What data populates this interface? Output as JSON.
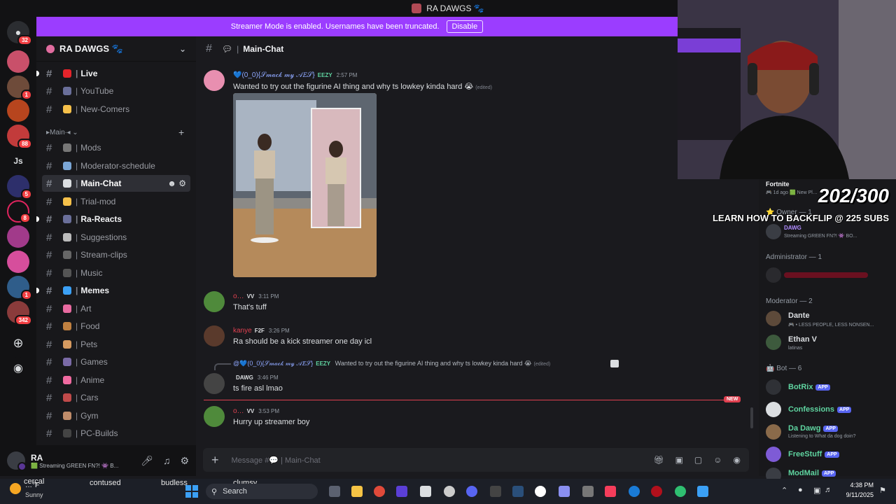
{
  "titlebar": {
    "server_name": "RA DAWGS 🐾"
  },
  "banner": {
    "text": "Streamer Mode is enabled. Usernames have been truncated.",
    "disable_label": "Disable"
  },
  "rail": {
    "badges": [
      "32",
      "1",
      "88",
      "Js",
      "5",
      "8",
      "1",
      "342"
    ],
    "colors": {
      "rail_bg": "#121214",
      "badge": "#f23f43"
    }
  },
  "sidebar": {
    "server_title": "RA DAWGS 🐾",
    "category_main": "▸Main∙◂ ⌄",
    "channels": [
      {
        "name": "Live",
        "icon": "red-dot-icon",
        "unread": true
      },
      {
        "name": "YouTube",
        "icon": "paw-icon",
        "unread": false
      },
      {
        "name": "New-Comers",
        "icon": "wave-icon",
        "unread": false
      },
      {
        "name": "Mods",
        "icon": "swords-icon",
        "unread": false
      },
      {
        "name": "Moderator-schedule",
        "icon": "calendar-icon",
        "unread": false
      },
      {
        "name": "Main-Chat",
        "icon": "speech-bubble-icon",
        "unread": false,
        "active": true
      },
      {
        "name": "Trial-mod",
        "icon": "emoji-icon",
        "unread": false
      },
      {
        "name": "Ra-Reacts",
        "icon": "paw-icon",
        "unread": true
      },
      {
        "name": "Suggestions",
        "icon": "thought-bubble-icon",
        "unread": false
      },
      {
        "name": "Stream-clips",
        "icon": "camera-icon",
        "unread": false
      },
      {
        "name": "Music",
        "icon": "music-icon",
        "unread": false
      },
      {
        "name": "Memes",
        "icon": "feather-icon",
        "unread": true
      },
      {
        "name": "Art",
        "icon": "palette-icon",
        "unread": false
      },
      {
        "name": "Food",
        "icon": "burger-icon",
        "unread": false
      },
      {
        "name": "Pets",
        "icon": "pet-icon",
        "unread": false
      },
      {
        "name": "Games",
        "icon": "controller-icon",
        "unread": false
      },
      {
        "name": "Anime",
        "icon": "flower-icon",
        "unread": false
      },
      {
        "name": "Cars",
        "icon": "car-icon",
        "unread": false
      },
      {
        "name": "Gym",
        "icon": "muscle-icon",
        "unread": false
      },
      {
        "name": "PC-Builds",
        "icon": "computer-icon",
        "unread": false
      }
    ],
    "separator": "|",
    "hash": "#"
  },
  "user_panel": {
    "name": "RA",
    "status": "🟩 Streaming GREEN FN?! 👾 B..."
  },
  "chat": {
    "header_channel": "Main-Chat",
    "header_prefix": "#",
    "messages": [
      {
        "author": "💙(0_0){𝒮𝓂𝒶𝒸𝓀 𝓂𝓎 𝒜𝐸𝒮}",
        "tag": "EEZY",
        "time": "2:57 PM",
        "text": "Wanted to try out the figurine AI thing and why ts lowkey kinda hard 😭",
        "edited": "(edited)"
      },
      {
        "author": "o…",
        "tag": "VV",
        "time": "3:11 PM",
        "text": "That's tuff"
      },
      {
        "author": "kanye",
        "tag": "F2F",
        "time": "3:26 PM",
        "text": "Ra should be a kick streamer one day icl"
      },
      {
        "reply_author": "@💙(0_0){𝒮𝓂𝒶𝒸𝓀 𝓂𝓎 𝒜𝐸𝒮}",
        "reply_tag": "EEZY",
        "reply_text": "Wanted to try out the figurine AI thing and why ts lowkey kinda hard 😭",
        "reply_edited": "(edited)",
        "author": "",
        "tag": "DAWG",
        "time": "3:46 PM",
        "text": "ts fire asl lmao"
      },
      {
        "author": "o…",
        "tag": "VV",
        "time": "3:53 PM",
        "text": "Hurry up streamer boy"
      }
    ],
    "new_label": "NEW",
    "input_placeholder": "Message #💬 | Main-Chat",
    "accent_colors": {
      "eezy": "#6f9dff",
      "vv": "#e04050",
      "kanye": "#e04050",
      "dawg": "#b08cff"
    }
  },
  "members": {
    "top_game": {
      "title": "Fortnite",
      "sub": "🎮 1d ago  🟩 New Pl…"
    },
    "owner_group": "⭐ Owner — 1",
    "owner": {
      "tag": "DAWG",
      "sub": "Streaming GREEN FN?! 👾 BO..."
    },
    "admin_group": "Administrator — 1",
    "mod_group": "Moderator — 2",
    "mods": [
      {
        "name": "Dante",
        "sub": "🎮 • LESS PEOPLE, LESS NONSEN..."
      },
      {
        "name": "Ethan V",
        "sub": "latinas"
      }
    ],
    "bot_group": "🤖 Bot — 6",
    "bots": [
      {
        "name": "BotRix",
        "badge": "APP",
        "sub": ""
      },
      {
        "name": "Confessions",
        "badge": "APP",
        "sub": ""
      },
      {
        "name": "Da Dawg",
        "badge": "APP",
        "sub": "Listening to What da dog doin?"
      },
      {
        "name": "FreeStuff",
        "badge": "APP",
        "sub": ""
      },
      {
        "name": "ModMail",
        "badge": "APP",
        "sub": ""
      }
    ]
  },
  "stream_overlay": {
    "count": "202/300",
    "goal": "LEARN HOW TO BACKFLIP @ 225 SUBS"
  },
  "taskbar": {
    "weather": {
      "temp": "…°F",
      "cond": "Sunny"
    },
    "search": "Search",
    "time": "4:38 PM",
    "date": "9/11/2025",
    "marquee": [
      "cercal",
      "contused",
      "budless",
      "clumsy"
    ]
  }
}
